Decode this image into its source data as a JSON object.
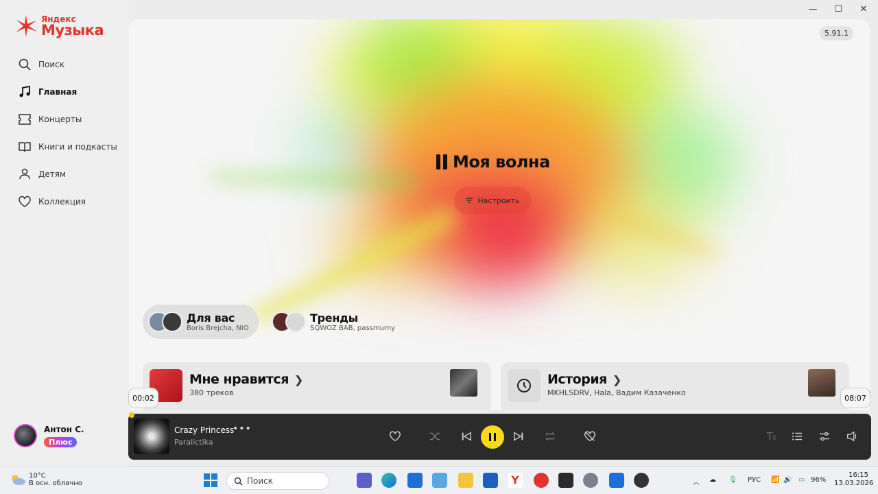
{
  "window": {
    "minimize": "—",
    "maximize": "☐",
    "close": "✕"
  },
  "logo": {
    "small": "Яндекс",
    "big": "Музыка"
  },
  "sidebar": {
    "items": [
      {
        "label": "Поиск",
        "icon": "search-icon"
      },
      {
        "label": "Главная",
        "icon": "music-note-icon",
        "active": true
      },
      {
        "label": "Концерты",
        "icon": "ticket-icon"
      },
      {
        "label": "Книги и подкасты",
        "icon": "book-icon"
      },
      {
        "label": "Детям",
        "icon": "kids-icon"
      },
      {
        "label": "Коллекция",
        "icon": "heart-icon"
      }
    ],
    "profile": {
      "name": "Антон С.",
      "badge": "Плюс"
    }
  },
  "main": {
    "version": "5.91.1",
    "wave_title": "Моя волна",
    "tune_label": "Настроить",
    "chips": [
      {
        "title": "Для вас",
        "subtitle": "Boris Brejcha, NIO",
        "selected": true
      },
      {
        "title": "Тренды",
        "subtitle": "SQWOZ BAB, passmurny",
        "selected": false
      }
    ],
    "cards": [
      {
        "title": "Мне нравится",
        "subtitle": "380 треков"
      },
      {
        "title": "История",
        "subtitle": "MKHLSDRV, Hala, Вадим Казаченко"
      }
    ],
    "time_elapsed": "00:02",
    "time_total": "08:07"
  },
  "player": {
    "track": "Crazy Princess",
    "artist": "Paralictika",
    "more": "•••",
    "progress_fraction": 0.004,
    "accent": "#fbd81a"
  },
  "taskbar": {
    "weather_temp": "10°C",
    "weather_desc": "В осн. облачно",
    "search_placeholder": "Поиск",
    "lang": "РУС",
    "battery": "96%",
    "time": "16:15",
    "date": "13.03.2026"
  },
  "colors": {
    "brand": "#e0352b",
    "player_bg": "#2b2b2b"
  }
}
